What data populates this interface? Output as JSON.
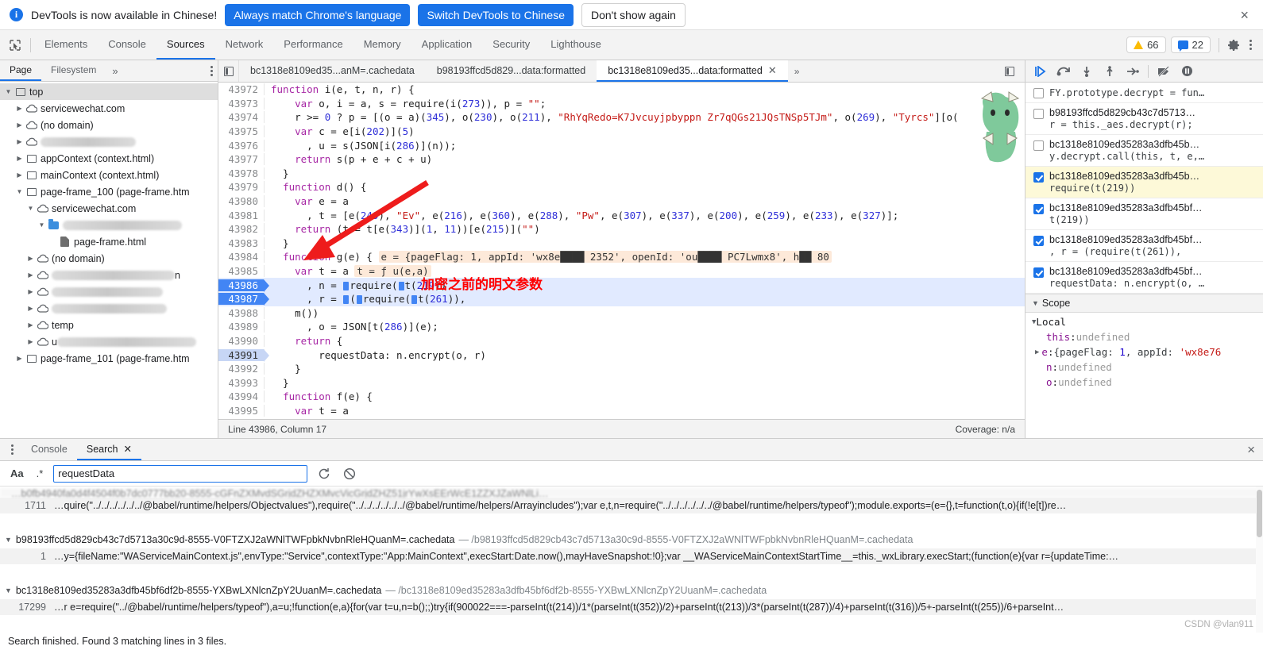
{
  "banner": {
    "icon": "info-icon",
    "message": "DevTools is now available in Chinese!",
    "btn_always": "Always match Chrome's language",
    "btn_switch": "Switch DevTools to Chinese",
    "btn_dismiss": "Don't show again",
    "close": "×"
  },
  "toolbar": {
    "inspect_icon": "inspect-element-icon",
    "device_icon": "device-toolbar-icon",
    "tabs": [
      {
        "label": "Elements",
        "active": false
      },
      {
        "label": "Console",
        "active": false
      },
      {
        "label": "Sources",
        "active": true
      },
      {
        "label": "Network",
        "active": false
      },
      {
        "label": "Performance",
        "active": false
      },
      {
        "label": "Memory",
        "active": false
      },
      {
        "label": "Application",
        "active": false
      },
      {
        "label": "Security",
        "active": false
      },
      {
        "label": "Lighthouse",
        "active": false
      }
    ],
    "warning_count": "66",
    "message_count": "22",
    "settings_icon": "gear-icon",
    "menu_icon": "kebab-menu-icon"
  },
  "navigator": {
    "tabs": [
      {
        "label": "Page",
        "active": true
      },
      {
        "label": "Filesystem",
        "active": false
      }
    ],
    "more": "»",
    "menu_icon": "kebab-menu-icon",
    "tree": [
      {
        "depth": 0,
        "twisty": "down",
        "icon": "frame",
        "label": "top",
        "selected": true
      },
      {
        "depth": 1,
        "twisty": "right",
        "icon": "cloud",
        "label": "servicewechat.com"
      },
      {
        "depth": 1,
        "twisty": "right",
        "icon": "cloud",
        "label": "(no domain)"
      },
      {
        "depth": 1,
        "twisty": "right",
        "icon": "cloud",
        "label": "",
        "redacted": 120
      },
      {
        "depth": 1,
        "twisty": "right",
        "icon": "frame",
        "label": "appContext (context.html)"
      },
      {
        "depth": 1,
        "twisty": "right",
        "icon": "frame",
        "label": "mainContext (context.html)"
      },
      {
        "depth": 1,
        "twisty": "down",
        "icon": "frame",
        "label": "page-frame_100 (page-frame.htm"
      },
      {
        "depth": 2,
        "twisty": "down",
        "icon": "cloud",
        "label": "servicewechat.com"
      },
      {
        "depth": 3,
        "twisty": "down",
        "icon": "folder",
        "label": "",
        "redacted": 150
      },
      {
        "depth": 4,
        "twisty": "none",
        "icon": "file",
        "label": "page-frame.html"
      },
      {
        "depth": 2,
        "twisty": "right",
        "icon": "cloud",
        "label": "(no domain)"
      },
      {
        "depth": 2,
        "twisty": "right",
        "icon": "cloud",
        "label": "",
        "redacted": 155,
        "suffix": "n"
      },
      {
        "depth": 2,
        "twisty": "right",
        "icon": "cloud",
        "label": "",
        "redacted": 140
      },
      {
        "depth": 2,
        "twisty": "right",
        "icon": "cloud",
        "label": "",
        "redacted": 145
      },
      {
        "depth": 2,
        "twisty": "right",
        "icon": "cloud",
        "label": "temp"
      },
      {
        "depth": 2,
        "twisty": "right",
        "icon": "cloud",
        "label": "u",
        "redacted": 175
      },
      {
        "depth": 1,
        "twisty": "right",
        "icon": "frame",
        "label": "page-frame_101 (page-frame.htm"
      }
    ]
  },
  "editor": {
    "nav_back_icon": "show-navigator-icon",
    "tabs": [
      {
        "label": "bc1318e8109ed35...anM=.cachedata",
        "active": false,
        "closable": false
      },
      {
        "label": "b98193ffcd5d829...data:formatted",
        "active": false,
        "closable": false
      },
      {
        "label": "bc1318e8109ed35...data:formatted",
        "active": true,
        "closable": true
      }
    ],
    "more": "»",
    "show_debugger_icon": "show-debugger-sidebar-icon",
    "annotation_note": "加密之前的明文参数",
    "status_left": "Line 43986, Column 17",
    "status_right": "Coverage: n/a",
    "lines": [
      {
        "no": "43972",
        "state": "clip",
        "code": "function i(e, t, n, r) {"
      },
      {
        "no": "43973",
        "state": "none",
        "code": "    var o, i = a, s = require(i(273)), p = \"\";"
      },
      {
        "no": "43974",
        "state": "none",
        "code": "    r >= 0 ? p = [(o = a)(345), o(230), o(211), \"RhYqRedo=K7Jvcuyjpbyppn Zr7qQGs21JQsTNSp5TJm\", o(269), \"Tyrcs\"][o("
      },
      {
        "no": "43975",
        "state": "none",
        "code": "    var c = e[i(202)](5)"
      },
      {
        "no": "43976",
        "state": "none",
        "code": "      , u = s(JSON[i(286)](n));"
      },
      {
        "no": "43977",
        "state": "none",
        "code": "    return s(p + e + c + u)"
      },
      {
        "no": "43978",
        "state": "none",
        "code": "  }"
      },
      {
        "no": "43979",
        "state": "none",
        "code": "  function d() {"
      },
      {
        "no": "43980",
        "state": "none",
        "code": "    var e = a"
      },
      {
        "no": "43981",
        "state": "none",
        "code": "      , t = [e(249), \"Ev\", e(216), e(360), e(288), \"Pw\", e(307), e(337), e(200), e(259), e(233), e(327)];"
      },
      {
        "no": "43982",
        "state": "none",
        "code": "    return (t = t[e(343)](1, 11))[e(215)](\"\")"
      },
      {
        "no": "43983",
        "state": "none",
        "code": "  }"
      },
      {
        "no": "43984",
        "state": "none",
        "code": "  function g(e) {",
        "inline": "e = {pageFlag: 1, appId: 'wx8e████ 2352', openId: 'ou████ PC7Lwmx8', h██ 80"
      },
      {
        "no": "43985",
        "state": "none",
        "code": "    var t = a",
        "inline2": "t = ƒ u(e,a)"
      },
      {
        "no": "43986",
        "state": "bp",
        "code": "      , n = ▶require(▶t(219))"
      },
      {
        "no": "43987",
        "state": "bp",
        "code": "      , r = ▶(▶require(▶t(261)),"
      },
      {
        "no": "43988",
        "state": "none",
        "code": "    m())"
      },
      {
        "no": "43989",
        "state": "none",
        "code": "      , o = JSON[t(286)](e);"
      },
      {
        "no": "43990",
        "state": "none",
        "code": "    return {"
      },
      {
        "no": "43991",
        "state": "cur",
        "code": "        requestData: n.encrypt(o, r)"
      },
      {
        "no": "43992",
        "state": "none",
        "code": "    }"
      },
      {
        "no": "43993",
        "state": "none",
        "code": "  }"
      },
      {
        "no": "43994",
        "state": "none",
        "code": "  function f(e) {"
      },
      {
        "no": "43995",
        "state": "none",
        "code": "    var t = a"
      }
    ]
  },
  "debugger": {
    "controls": [
      {
        "name": "resume-script-execution",
        "glyph": "▶"
      },
      {
        "name": "step-over-next-function-call",
        "glyph": "↷"
      },
      {
        "name": "step-into-next-function-call",
        "glyph": "↓"
      },
      {
        "name": "step-out-of-current-function",
        "glyph": "↑"
      },
      {
        "name": "step",
        "glyph": "→"
      },
      {
        "name": "deactivate-breakpoints",
        "glyph": "⊘"
      },
      {
        "name": "pause-on-exceptions",
        "glyph": "⏸"
      }
    ],
    "breakpoints": [
      {
        "checked": false,
        "file": "",
        "snippet": "FY.prototype.decrypt = fun…",
        "highlight": false,
        "partial": true
      },
      {
        "checked": false,
        "file": "b98193ffcd5d829cb43c7d5713…",
        "snippet": "r = this._aes.decrypt(r);",
        "highlight": false
      },
      {
        "checked": false,
        "file": "bc1318e8109ed35283a3dfb45b…",
        "snippet": "y.decrypt.call(this, t, e,…",
        "highlight": false
      },
      {
        "checked": true,
        "file": "bc1318e8109ed35283a3dfb45b…",
        "snippet": "require(t(219))",
        "highlight": true
      },
      {
        "checked": true,
        "file": "bc1318e8109ed35283a3dfb45bf…",
        "snippet": "t(219))",
        "highlight": false
      },
      {
        "checked": true,
        "file": "bc1318e8109ed35283a3dfb45bf…",
        "snippet": ", r = (require(t(261)),",
        "highlight": false
      },
      {
        "checked": true,
        "file": "bc1318e8109ed35283a3dfb45bf…",
        "snippet": "requestData: n.encrypt(o, …",
        "highlight": false
      }
    ],
    "scope_header": "Scope",
    "scope_group": "Local",
    "scope_vars": [
      {
        "name": "this",
        "value": "undefined",
        "kind": "undef",
        "twisty": false
      },
      {
        "name": "e",
        "value": "{pageFlag: 1, appId: 'wx8e76",
        "kind": "object",
        "twisty": true
      },
      {
        "name": "n",
        "value": "undefined",
        "kind": "undef",
        "twisty": false
      },
      {
        "name": "o",
        "value": "undefined",
        "kind": "undef",
        "twisty": false
      }
    ]
  },
  "drawer": {
    "menu_icon": "kebab-menu-icon",
    "tabs": [
      {
        "label": "Console",
        "active": false,
        "closable": false
      },
      {
        "label": "Search",
        "active": true,
        "closable": true
      }
    ],
    "close": "×",
    "search": {
      "match_case_label": "Aa",
      "regex_label": ".*",
      "value": "requestData",
      "placeholder": "Search",
      "refresh_icon": "refresh-icon",
      "clear_icon": "clear-icon"
    },
    "results": [
      {
        "type": "line",
        "no": "1711",
        "text": "…quire(\"../../../../../../@babel/runtime/helpers/Objectvalues\"),require(\"../../../../../../@babel/runtime/helpers/Arrayincludes\");var e,t,n=require(\"../../../../../../@babel/runtime/helpers/typeof\");module.exports=(e={},t=function(t,o){if(!e[t])re…"
      },
      {
        "type": "group",
        "name": "b98193ffcd5d829cb43c7d5713a30c9d-8555-V0FTZXJ2aWNlTWFpbkNvbnRleHQuanM=.cachedata",
        "path": "/b98193ffcd5d829cb43c7d5713a30c9d-8555-V0FTZXJ2aWNlTWFpbkNvbnRleHQuanM=.cachedata"
      },
      {
        "type": "line",
        "no": "1",
        "text": "…y={fileName:\"WAServiceMainContext.js\",envType:\"Service\",contextType:\"App:MainContext\",execStart:Date.now(),mayHaveSnapshot:!0};var __WAServiceMainContextStartTime__=this._wxLibrary.execStart;(function(e){var r={updateTime:…"
      },
      {
        "type": "group",
        "name": "bc1318e8109ed35283a3dfb45bf6df2b-8555-YXBwLXNlcnZpY2UuanM=.cachedata",
        "path": "/bc1318e8109ed35283a3dfb45bf6df2b-8555-YXBwLXNlcnZpY2UuanM=.cachedata"
      },
      {
        "type": "line",
        "no": "17299",
        "text": "…r e=require(\"../@babel/runtime/helpers/typeof\"),a=u;!function(e,a){for(var t=u,n=b();;)try{if(900022===-parseInt(t(214))/1*(parseInt(t(352))/2)+parseInt(t(213))/3*(parseInt(t(287))/4)+parseInt(t(316))/5+-parseInt(t(255))/6+parseInt…"
      }
    ],
    "status": "Search finished.  Found 3 matching lines in 3 files.",
    "watermark": "CSDN @vlan911"
  },
  "colors": {
    "accent": "#1a73e8",
    "breakpoint": "#4285f4",
    "annotation_red": "#ff0000",
    "highlight_yellow": "#fdf9d8",
    "inline_value_bg": "#fde9d9"
  }
}
